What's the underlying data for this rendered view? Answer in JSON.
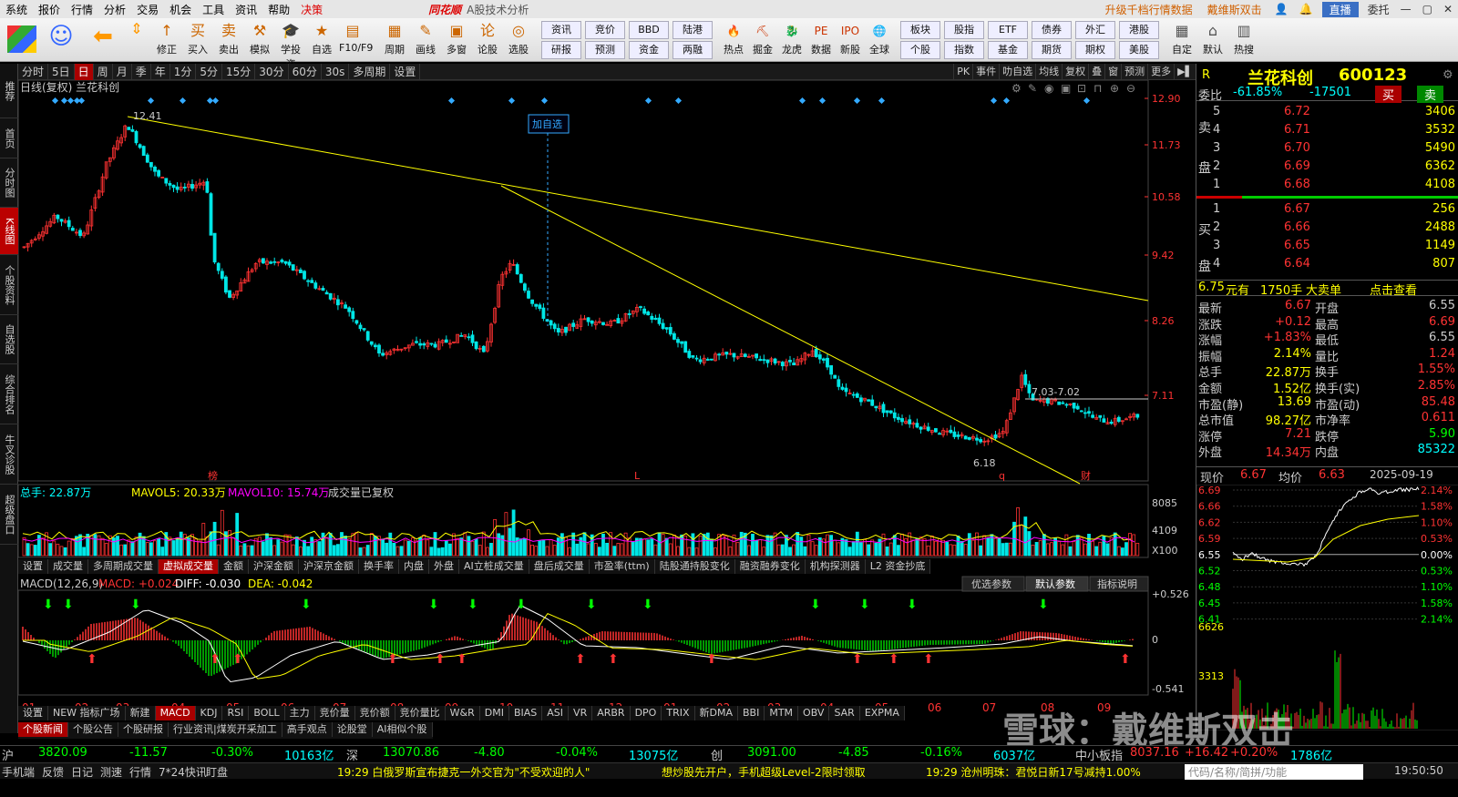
{
  "menu": {
    "items": [
      "系统",
      "报价",
      "行情",
      "分析",
      "交易",
      "机会",
      "工具",
      "资讯",
      "帮助"
    ],
    "highlight": "决策",
    "brand": "同花顺",
    "subtitle": "A股技术分析",
    "promo1": "升级千档行情数据",
    "promo2": "戴维斯双击",
    "live": "直播",
    "user": "委托"
  },
  "toolbar": {
    "big": [
      {
        "label": "修正",
        "icon": "↑"
      },
      {
        "label": "买入",
        "icon": "买"
      },
      {
        "label": "卖出",
        "icon": "卖"
      },
      {
        "label": "模拟",
        "icon": "⚒"
      },
      {
        "label": "学投资",
        "icon": "🎓"
      },
      {
        "label": "自选",
        "icon": "★"
      },
      {
        "label": "F10/F9",
        "icon": "▤"
      },
      {
        "label": "周期",
        "icon": "▦"
      },
      {
        "label": "画线",
        "icon": "✎"
      },
      {
        "label": "多窗",
        "icon": "▣"
      },
      {
        "label": "论股",
        "icon": "论"
      },
      {
        "label": "选股",
        "icon": "◎"
      }
    ],
    "grid": [
      [
        "资讯",
        "竞价",
        "BBD",
        "陆港"
      ],
      [
        "研报",
        "预测",
        "资金",
        "两融"
      ]
    ],
    "big2": [
      {
        "label": "热点",
        "icon": "🔥"
      },
      {
        "label": "掘金",
        "icon": "⛏"
      },
      {
        "label": "龙虎",
        "icon": "🐉"
      },
      {
        "label": "数据",
        "icon": "PE"
      },
      {
        "label": "新股",
        "icon": "IPO"
      },
      {
        "label": "全球",
        "icon": "🌐"
      }
    ],
    "grid2": [
      [
        "板块",
        "股指",
        "ETF",
        "债券",
        "外汇",
        "港股"
      ],
      [
        "个股",
        "指数",
        "基金",
        "期货",
        "期权",
        "美股"
      ]
    ],
    "big3": [
      {
        "label": "自定",
        "icon": "▦"
      },
      {
        "label": "默认",
        "icon": "⌂"
      },
      {
        "label": "热搜",
        "icon": "▥"
      }
    ]
  },
  "leftnav": [
    "推荐",
    "首页",
    "分时图",
    "K线图",
    "个股资料",
    "自选股",
    "综合排名",
    "牛叉诊股",
    "超级盘口"
  ],
  "periodbar": {
    "items": [
      "分时",
      "5日",
      "日",
      "周",
      "月",
      "季",
      "年",
      "1分",
      "5分",
      "15分",
      "30分",
      "60分",
      "30s",
      "多周期",
      "设置"
    ],
    "active": "日",
    "right": [
      "PK",
      "事件",
      "叻自选",
      "均线",
      "复权",
      "叠",
      "窗",
      "预测",
      "更多"
    ]
  },
  "kline": {
    "title": "日线(复权) 兰花科创",
    "yticks": [
      "12.90",
      "11.73",
      "10.58",
      "9.42",
      "8.26",
      "7.11"
    ],
    "hi_label": "12.41",
    "lo_label": "6.18",
    "range_label": "7.03-7.02",
    "add_label": "加自选",
    "markers": [
      "榜",
      "L",
      "q",
      "财"
    ]
  },
  "volume": {
    "label_total": "总手: 22.87万",
    "label_ma5": "MAVOL5: 20.33万",
    "label_ma10": "MAVOL10: 15.74万",
    "label_note": "成交量已复权",
    "yticks": [
      "8085",
      "4109",
      "X100"
    ]
  },
  "voltabs": [
    "设置",
    "成交量",
    "多周期成交量",
    "虚拟成交量",
    "金额",
    "沪深金额",
    "沪深京金额",
    "换手率",
    "内盘",
    "外盘",
    "AI立桩成交量",
    "盘后成交量",
    "市盈率(ttm)",
    "陆股通持股变化",
    "融资融券变化",
    "机构探测器",
    "L2 资金抄底"
  ],
  "macd": {
    "label": "MACD(12,26,9)",
    "macd": "MACD: +0.024",
    "diff": "DIFF: -0.030",
    "dea": "DEA: -0.042",
    "btn1": "优选参数",
    "btn2": "默认参数",
    "btn3": "指标说明",
    "yticks": [
      "+0.526",
      "0",
      "-0.541"
    ]
  },
  "xaxis": [
    "01",
    "02",
    "03",
    "04",
    "05",
    "06",
    "07",
    "08",
    "09",
    "10",
    "11",
    "12",
    "01",
    "02",
    "03",
    "04",
    "05",
    "06",
    "07",
    "08",
    "09"
  ],
  "indtabs": [
    "设置",
    "NEW 指标广场",
    "新建",
    "MACD",
    "KDJ",
    "RSI",
    "BOLL",
    "主力",
    "竞价量",
    "竞价额",
    "竞价量比",
    "W&R",
    "DMI",
    "BIAS",
    "ASI",
    "VR",
    "ARBR",
    "DPO",
    "TRIX",
    "新DMA",
    "BBI",
    "MTM",
    "OBV",
    "SAR",
    "EXPMA"
  ],
  "newstabs": [
    "个股新闻",
    "个股公告",
    "个股研报",
    "行业资讯|煤炭开采加工",
    "高手观点",
    "论股堂",
    "AI相似个股"
  ],
  "stock": {
    "flag": "R",
    "name": "兰花科创",
    "code": "600123",
    "weibi_label": "委比",
    "weibi": "-61.85%",
    "weicha": "-17501",
    "buy": "买",
    "sell": "卖"
  },
  "asks": [
    [
      "5",
      "6.72",
      "3406"
    ],
    [
      "4",
      "6.71",
      "3532"
    ],
    [
      "3",
      "6.70",
      "5490"
    ],
    [
      "2",
      "6.69",
      "6362"
    ],
    [
      "1",
      "6.68",
      "4108"
    ]
  ],
  "bids": [
    [
      "1",
      "6.67",
      "256"
    ],
    [
      "2",
      "6.66",
      "2488"
    ],
    [
      "3",
      "6.65",
      "1149"
    ],
    [
      "4",
      "6.64",
      "807"
    ]
  ],
  "asklabel": [
    "卖",
    "盘"
  ],
  "bidlabel": [
    "买",
    "盘"
  ],
  "bigorder": {
    "price": "6.75",
    "t1": "元有",
    "vol": "1750手",
    "t2": "大卖单",
    "link": "点击查看"
  },
  "stats": [
    [
      "最新",
      "6.67",
      "开盘",
      "6.55"
    ],
    [
      "涨跌",
      "+0.12",
      "最高",
      "6.69"
    ],
    [
      "涨幅",
      "+1.83%",
      "最低",
      "6.55"
    ],
    [
      "振幅",
      "2.14%",
      "量比",
      "1.24"
    ],
    [
      "总手",
      "22.87万",
      "换手",
      "1.55%"
    ],
    [
      "金额",
      "1.52亿",
      "换手(实)",
      "2.85%"
    ],
    [
      "市盈(静)",
      "13.69",
      "市盈(动)",
      "85.48"
    ],
    [
      "总市值",
      "98.27亿",
      "市净率",
      "0.611"
    ],
    [
      "涨停",
      "7.21",
      "跌停",
      "5.90"
    ],
    [
      "外盘",
      "14.34万",
      "内盘",
      "85322"
    ]
  ],
  "mini": {
    "xianjia_label": "现价",
    "xianjia": "6.67",
    "junjia_label": "均价",
    "junjia": "6.63",
    "date": "2025-09-19",
    "left": [
      "6.69",
      "6.66",
      "6.62",
      "6.59",
      "6.55",
      "6.52",
      "6.48",
      "6.45",
      "6.41"
    ],
    "right": [
      "2.14%",
      "1.58%",
      "1.10%",
      "0.53%",
      "0.00%",
      "0.53%",
      "1.10%",
      "1.58%",
      "2.14%"
    ],
    "vol": [
      "6626",
      "3313"
    ]
  },
  "indexbar": [
    [
      "沪",
      "3820.09",
      "-11.57",
      "-0.30%",
      "10163亿"
    ],
    [
      "深",
      "13070.86",
      "-4.80",
      "-0.04%",
      "13075亿"
    ],
    [
      "创",
      "3091.00",
      "-4.85",
      "-0.16%",
      "6037亿"
    ],
    [
      "中小板指",
      "8037.16",
      "+16.42",
      "+0.20%",
      "1786亿"
    ]
  ],
  "status": {
    "items": [
      "手机端",
      "反馈",
      "日记",
      "测速",
      "行情",
      "7*24快讯",
      "盯盘"
    ],
    "news1": "19:29 白俄罗斯宣布捷克一外交官为\"不受欢迎的人\"",
    "promo": "想炒股先开户，手机超级Level-2限时领取",
    "news2": "19:29 沧州明珠：君悦日新17号减持1.00%",
    "search": "代码/名称/简拼/功能",
    "time": "19:50:50"
  },
  "watermark": "雪球：戴维斯双击",
  "colors": {
    "up": "#ff3232",
    "down": "#00e6e6",
    "bg": "#000000",
    "ma": "#ffff00"
  }
}
